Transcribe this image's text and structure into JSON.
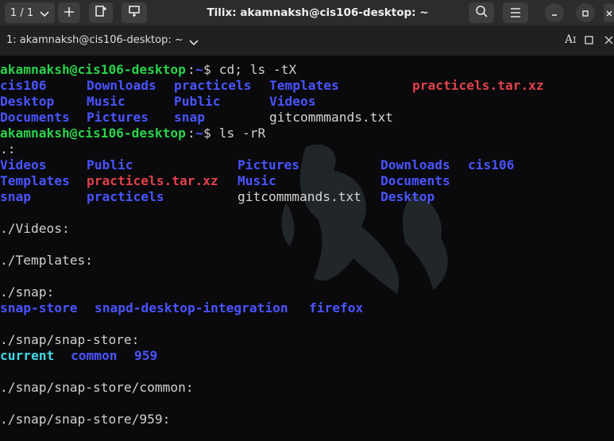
{
  "titlebar": {
    "tab_counter": "1 / 1",
    "title": "Tilix: akamnaksh@cis106-desktop: ~"
  },
  "tabbar": {
    "session_label": "1: akamnaksh@cis106-desktop: ~"
  },
  "icons": [
    "chevron-down-icon",
    "plus-icon",
    "split-vertical-icon",
    "split-horizontal-icon",
    "search-icon",
    "hamburger-menu-icon",
    "minimize-icon",
    "maximize-icon",
    "close-icon",
    "read-only-icon",
    "maximize-terminal-icon",
    "close-terminal-icon"
  ],
  "colors": {
    "directory": "#4a54ff",
    "archive": "#e2414b",
    "prompt_user": "#2bd14a",
    "file": "#d6d6d6",
    "background": "#0a0a0c"
  },
  "terminal": {
    "prompt1": {
      "user": "akamnaksh@cis106-desktop",
      "path": "~",
      "symbol": "$",
      "command": " cd; ls -tX"
    },
    "ls_tx": [
      [
        {
          "text": "cis106",
          "type": "dir"
        },
        {
          "text": "Downloads",
          "type": "dir"
        },
        {
          "text": "practicels",
          "type": "dir"
        },
        {
          "text": "Templates",
          "type": "dir"
        },
        {
          "text": "practicels.tar.xz",
          "type": "arc"
        }
      ],
      [
        {
          "text": "Desktop",
          "type": "dir"
        },
        {
          "text": "Music",
          "type": "dir"
        },
        {
          "text": "Public",
          "type": "dir"
        },
        {
          "text": "Videos",
          "type": "dir"
        }
      ],
      [
        {
          "text": "Documents",
          "type": "dir"
        },
        {
          "text": "Pictures",
          "type": "dir"
        },
        {
          "text": "snap",
          "type": "dir"
        },
        {
          "text": "gitcommmands.txt",
          "type": "fil"
        }
      ]
    ],
    "prompt2": {
      "user": "akamnaksh@cis106-desktop",
      "path": "~",
      "symbol": "$",
      "command": " ls -rR"
    },
    "dot_header": ".:",
    "ls_rr": [
      [
        {
          "text": "Videos",
          "type": "dir"
        },
        {
          "text": "Public",
          "type": "dir"
        },
        {
          "text": "Pictures",
          "type": "dir"
        },
        {
          "text": "Downloads",
          "type": "dir"
        },
        {
          "text": "cis106",
          "type": "dir"
        }
      ],
      [
        {
          "text": "Templates",
          "type": "dir"
        },
        {
          "text": "practicels.tar.xz",
          "type": "arc"
        },
        {
          "text": "Music",
          "type": "dir"
        },
        {
          "text": "Documents",
          "type": "dir"
        }
      ],
      [
        {
          "text": "snap",
          "type": "dir"
        },
        {
          "text": "practicels",
          "type": "dir"
        },
        {
          "text": "gitcommmands.txt",
          "type": "fil"
        },
        {
          "text": "Desktop",
          "type": "dir"
        }
      ]
    ],
    "videos_header": "./Videos:",
    "templates_header": "./Templates:",
    "snap_header": "./snap:",
    "snap_list": [
      {
        "text": "snap-store",
        "type": "dir"
      },
      {
        "text": "snapd-desktop-integration",
        "type": "dir"
      },
      {
        "text": "firefox",
        "type": "dir"
      }
    ],
    "snapstore_header": "./snap/snap-store:",
    "snapstore_list": [
      {
        "text": "current",
        "type": "cyn"
      },
      {
        "text": "common",
        "type": "dir"
      },
      {
        "text": "959",
        "type": "dir"
      }
    ],
    "common_header": "./snap/snap-store/common:",
    "v959_header": "./snap/snap-store/959:"
  }
}
